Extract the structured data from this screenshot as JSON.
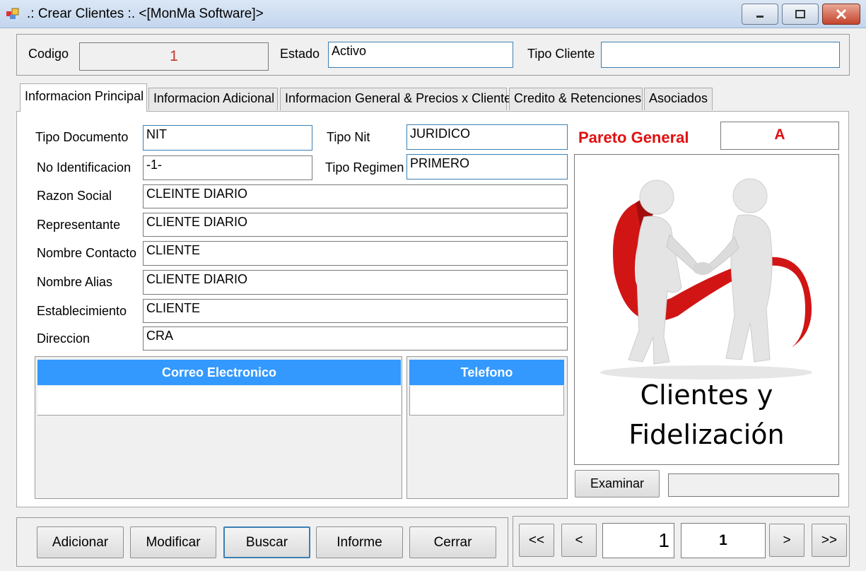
{
  "window": {
    "title": ".: Crear Clientes :. <[MonMa Software]>"
  },
  "header": {
    "codigo_label": "Codigo",
    "codigo_value": "1",
    "estado_label": "Estado",
    "estado_value": "Activo",
    "tipo_cliente_label": "Tipo Cliente",
    "tipo_cliente_value": ""
  },
  "tabs": [
    {
      "label": "Informacion Principal",
      "active": true
    },
    {
      "label": "Informacion Adicional"
    },
    {
      "label": "Informacion General & Precios x Cliente"
    },
    {
      "label": "Credito & Retenciones"
    },
    {
      "label": "Asociados"
    }
  ],
  "form": {
    "tipo_documento_label": "Tipo Documento",
    "tipo_documento_value": "NIT",
    "tipo_nit_label": "Tipo Nit",
    "tipo_nit_value": "JURIDICO",
    "no_identificacion_label": "No Identificacion",
    "no_identificacion_value": "-1-",
    "tipo_regimen_label": "Tipo Regimen",
    "tipo_regimen_value": "PRIMERO",
    "razon_social_label": "Razon Social",
    "razon_social_value": "CLEINTE DIARIO",
    "representante_label": "Representante",
    "representante_value": "CLIENTE DIARIO",
    "nombre_contacto_label": "Nombre Contacto",
    "nombre_contacto_value": "CLIENTE",
    "nombre_alias_label": "Nombre Alias",
    "nombre_alias_value": "CLIENTE DIARIO",
    "establecimiento_label": "Establecimiento",
    "establecimiento_value": "CLIENTE",
    "direccion_label": "Direccion",
    "direccion_value": "CRA"
  },
  "grids": {
    "correo_header": "Correo Electronico",
    "telefono_header": "Telefono"
  },
  "pareto": {
    "label": "Pareto General",
    "value": "A"
  },
  "image": {
    "caption_line1": "Clientes y",
    "caption_line2": "Fidelización"
  },
  "examinar": {
    "button": "Examinar",
    "path_value": ""
  },
  "actions": {
    "adicionar": "Adicionar",
    "modificar": "Modificar",
    "buscar": "Buscar",
    "informe": "Informe",
    "cerrar": "Cerrar"
  },
  "navigation": {
    "first": "<<",
    "prev": "<",
    "current": "1",
    "total": "1",
    "next": ">",
    "last": ">>"
  },
  "colors": {
    "accent": "#3399ff",
    "pareto_red": "#e01010",
    "field_border_focus": "#3c7fb1"
  }
}
